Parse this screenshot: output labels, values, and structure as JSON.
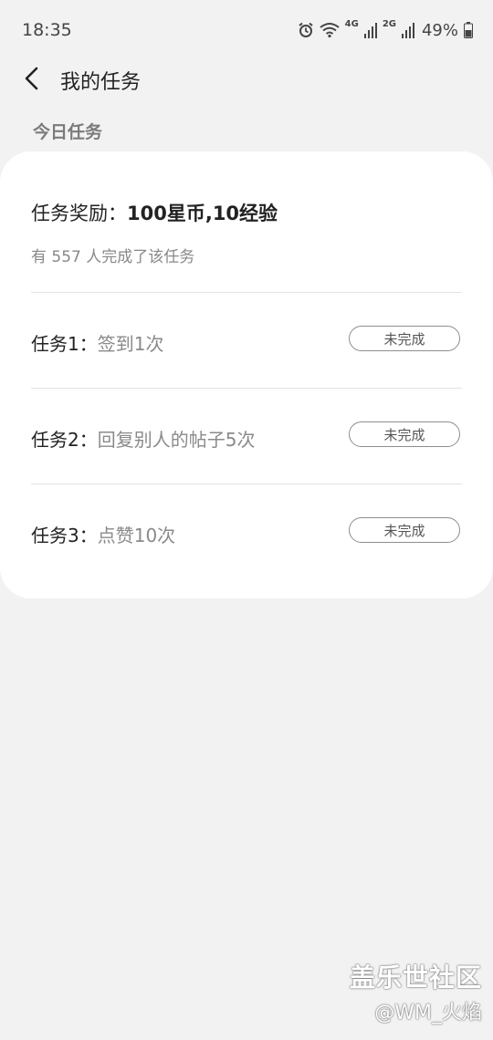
{
  "status_bar": {
    "time": "18:35",
    "network_4g": "4G",
    "network_2g": "2G",
    "battery": "49%",
    "icons": [
      "alarm-icon",
      "wifi-icon",
      "signal-icon",
      "signal-icon",
      "battery-icon"
    ]
  },
  "app_bar": {
    "back_icon": "chevron-left-icon",
    "title": "我的任务"
  },
  "section": {
    "title": "今日任务"
  },
  "card": {
    "reward_prefix": "任务奖励：",
    "reward_value": "100星币,10经验",
    "completed_text": "有 557 人完成了该任务",
    "tasks": [
      {
        "prefix": "任务1：",
        "desc": "签到1次",
        "status": "未完成"
      },
      {
        "prefix": "任务2：",
        "desc": "回复别人的帖子5次",
        "status": "未完成"
      },
      {
        "prefix": "任务3：",
        "desc": "点赞10次",
        "status": "未完成"
      }
    ]
  },
  "watermark": {
    "main": "盖乐世社区",
    "sub": "@WM_火焰"
  },
  "colors": {
    "background": "#f2f2f2",
    "card": "#ffffff",
    "muted_text": "#888888"
  }
}
